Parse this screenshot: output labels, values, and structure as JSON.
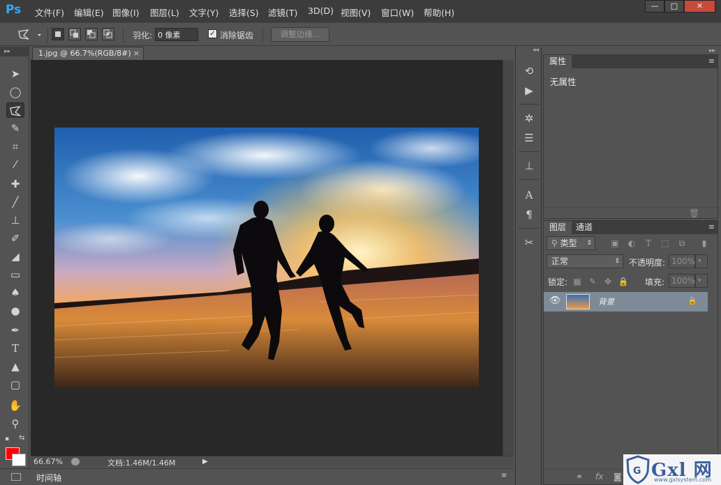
{
  "app": {
    "logo": "Ps",
    "menu": [
      "文件(F)",
      "编辑(E)",
      "图像(I)",
      "图层(L)",
      "文字(Y)",
      "选择(S)",
      "滤镜(T)",
      "3D(D)",
      "视图(V)",
      "窗口(W)",
      "帮助(H)"
    ],
    "window_controls": {
      "minimize": "—",
      "restore": "□",
      "close": "✕"
    }
  },
  "options": {
    "feather_label": "羽化:",
    "feather_value": "0 像素",
    "antialias_label": "消除锯齿",
    "antialias_checked": true,
    "refine_edge_label": "调整边缘..."
  },
  "document": {
    "tab_title": "1.jpg @ 66.7%(RGB/8#)",
    "close_glyph": "×",
    "zoom": "66.67%",
    "doc_info": "文档:1.46M/1.46M"
  },
  "timeline": {
    "label": "时间轴"
  },
  "properties_panel": {
    "tab": "属性",
    "empty_text": "无属性"
  },
  "layers_panel": {
    "tabs": [
      "图层",
      "通道"
    ],
    "filter_kind": "类型",
    "blend_mode": "正常",
    "opacity_label": "不透明度:",
    "opacity_value": "100%",
    "lock_label": "锁定:",
    "fill_label": "填充:",
    "fill_value": "100%",
    "layer_name": "背景"
  },
  "watermark": {
    "brand": "Gxl 网",
    "url": "www.gxlsystem.com"
  },
  "colors": {
    "foreground": "#ff0000",
    "background": "#ffffff",
    "ps_blue": "#31a8ff"
  }
}
